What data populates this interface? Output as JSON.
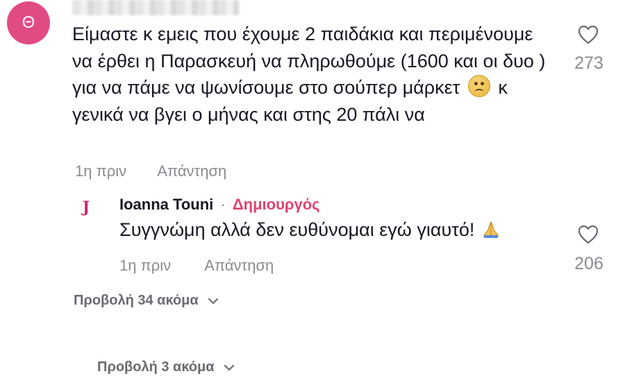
{
  "comment": {
    "avatar_letter": "Θ",
    "text_before_emoji": "Είμαστε κ εμεις που έχουμε 2 παιδάκια και περιμένουμε να έρθει η Παρασκευή να πληρωθούμε (1600 και οι δυο ) για να πάμε να ψωνίσουμε στο σούπερ μάρκετ",
    "emoji": "worried-face-emoji",
    "text_after_emoji": "κ γενικά να βγει ο μήνας και στης 20 πάλι να",
    "time": "1η πριν",
    "reply_label": "Απάντηση",
    "like_count": "273"
  },
  "reply": {
    "avatar_letter": "J",
    "author": "Ioanna Touni",
    "separator": "·",
    "creator_badge": "Δημιουργός",
    "text": "Συγγνώμη αλλά δεν ευθύνομαι εγώ γιαυτό!",
    "emoji": "folded-hands-emoji",
    "time": "1η πριν",
    "reply_label": "Απάντηση",
    "like_count": "206"
  },
  "view_more_replies": "Προβολή 34 ακόμα",
  "view_more_comments": "Προβολή 3 ακόμα",
  "colors": {
    "avatar_bg": "#e14b84",
    "creator_badge": "#e0446e",
    "secondary_text": "#8a8b91"
  }
}
